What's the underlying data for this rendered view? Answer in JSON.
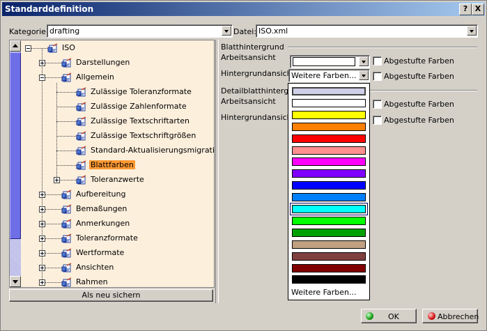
{
  "window": {
    "title": "Standarddefinition",
    "help_label": "?",
    "close_label": "X"
  },
  "top": {
    "category_label": "Kategorie:",
    "category_value": "drafting",
    "file_label": "Datei:",
    "file_value": "ISO.xml"
  },
  "tree": {
    "root": "ISO",
    "nodes": [
      {
        "label": "Darstellungen"
      },
      {
        "label": "Allgemein"
      },
      {
        "label": "Zulässige Toleranzformate"
      },
      {
        "label": "Zulässige Zahlenformate"
      },
      {
        "label": "Zulässige Textschriftarten"
      },
      {
        "label": "Zulässige Textschriftgrößen"
      },
      {
        "label": "Standard-Aktualisierungsmigration"
      },
      {
        "label": "Blattfarben"
      },
      {
        "label": "Toleranzwerte"
      },
      {
        "label": "Aufbereitung"
      },
      {
        "label": "Bemaßungen"
      },
      {
        "label": "Anmerkungen"
      },
      {
        "label": "Toleranzformate"
      },
      {
        "label": "Wertformate"
      },
      {
        "label": "Ansichten"
      },
      {
        "label": "Rahmen"
      }
    ]
  },
  "save_as_new_label": "Als neu sichern",
  "settings": {
    "sheet_bg_group": "Blatthintergrund",
    "work_view_label": "Arbeitsansicht",
    "bg_view_label": "Hintergrundansicht",
    "bg_view_value": "Weitere Farben...",
    "graded_label_1": "Abgestufte Farben",
    "graded_label_2": "Abgestufte Farben",
    "detail_group": "Detailblatthintergrund",
    "detail_work_label": "Arbeitsansicht",
    "detail_bg_label": "Hintergrundansicht",
    "graded_label_3": "Abgestufte Farben",
    "graded_label_4": "Abgestufte Farben"
  },
  "color_dropdown": {
    "colors": [
      "#cfcfe8",
      "#ffffff",
      "#ffff00",
      "#ff8000",
      "#ff0000",
      "#ff9090",
      "#ff00ff",
      "#8000ff",
      "#0000ff",
      "#0080ff",
      "#00ffff",
      "#00ff00",
      "#00a000",
      "#c0a080",
      "#804040",
      "#800000",
      "#000000"
    ],
    "more_label": "Weitere Farben..."
  },
  "buttons": {
    "ok": "OK",
    "cancel": "Abbrechen"
  }
}
